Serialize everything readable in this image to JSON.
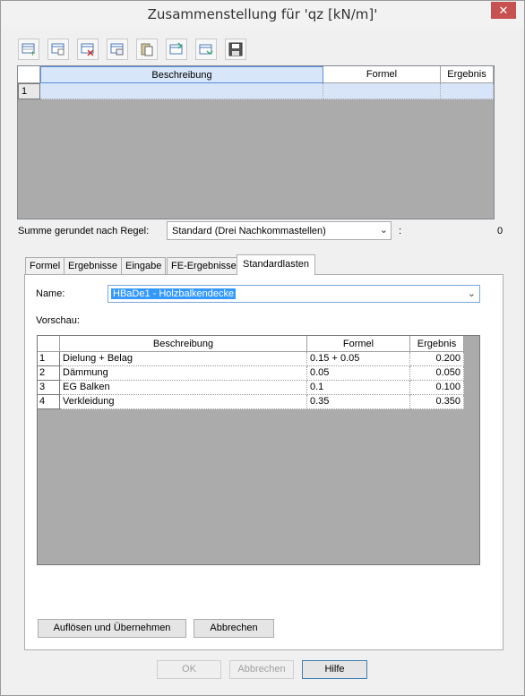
{
  "window": {
    "title": "Zusammenstellung für 'qz [kN/m]'",
    "close_glyph": "✕"
  },
  "toolbar": {
    "icons": [
      "insert-row-icon",
      "copy-row-icon",
      "delete-row-icon",
      "duplicate-row-icon",
      "paste-icon",
      "export-icon",
      "import-icon",
      "save-icon"
    ]
  },
  "grid_top": {
    "columns": [
      "",
      "Beschreibung",
      "Formel",
      "Ergebnis"
    ],
    "rows": [
      {
        "number": "1",
        "beschreibung": "",
        "formel": "",
        "ergebnis": ""
      }
    ]
  },
  "summe": {
    "label": "Summe gerundet nach Regel:",
    "selected": "Standard (Drei Nachkommastellen)",
    "colon": ":",
    "value": "0"
  },
  "tabs": [
    {
      "label": "Formel",
      "active": false
    },
    {
      "label": "Ergebnisse",
      "active": false
    },
    {
      "label": "Eingabe",
      "active": false
    },
    {
      "label": "FE-Ergebnisse",
      "active": false
    },
    {
      "label": "Standardlasten",
      "active": true
    }
  ],
  "standardlasten": {
    "name_label": "Name:",
    "name_value": "HBaDe1 - Holzbalkendecke",
    "preview_label": "Vorschau:",
    "columns": [
      "",
      "Beschreibung",
      "Formel",
      "Ergebnis"
    ],
    "rows": [
      {
        "number": "1",
        "beschreibung": "Dielung + Belag",
        "formel": "0.15 + 0.05",
        "ergebnis": "0.200"
      },
      {
        "number": "2",
        "beschreibung": "Dämmung",
        "formel": "0.05",
        "ergebnis": "0.050"
      },
      {
        "number": "3",
        "beschreibung": "EG Balken",
        "formel": "0.1",
        "ergebnis": "0.100"
      },
      {
        "number": "4",
        "beschreibung": "Verkleidung",
        "formel": "0.35",
        "ergebnis": "0.350"
      }
    ],
    "apply_button": "Auflösen und Übernehmen",
    "cancel_button": "Abbrechen"
  },
  "footer": {
    "ok": "OK",
    "cancel": "Abbrechen",
    "help": "Hilfe"
  },
  "colors": {
    "selection": "#3399ff",
    "grid_selection": "#d8e4f8",
    "close": "#c75050"
  }
}
